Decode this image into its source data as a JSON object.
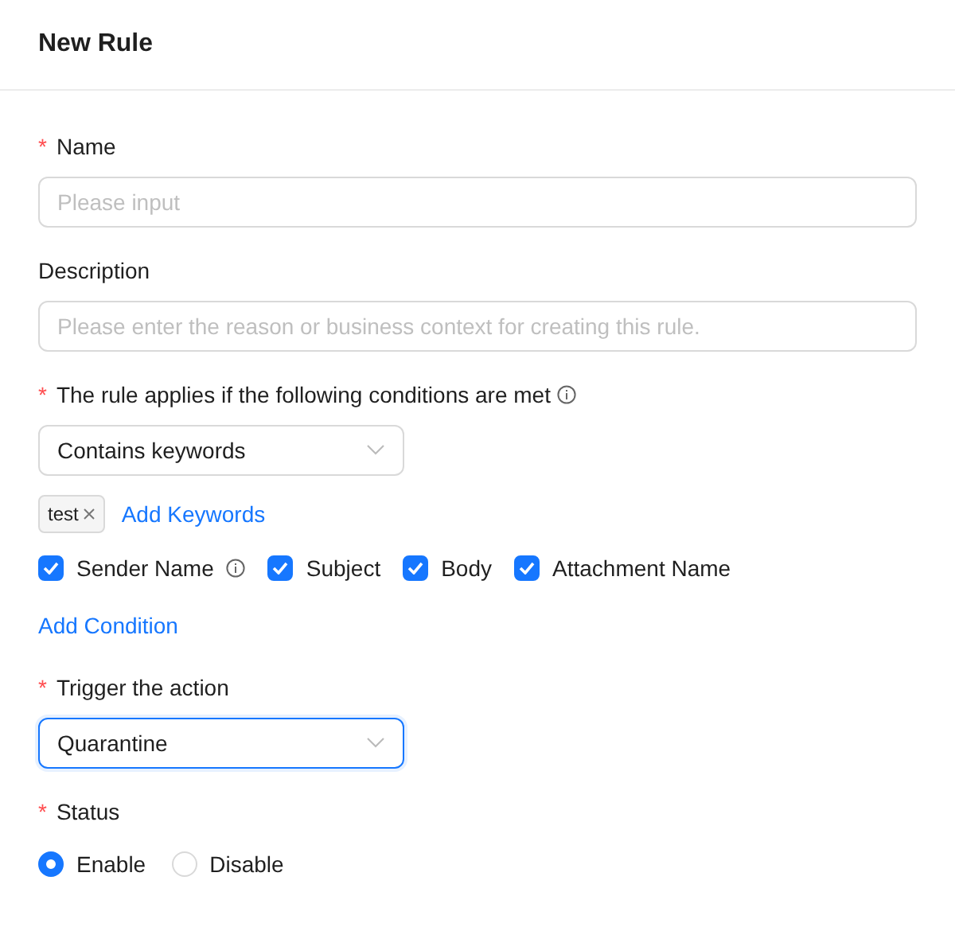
{
  "header": {
    "title": "New Rule"
  },
  "name_field": {
    "required_mark": "*",
    "label": "Name",
    "placeholder": "Please input"
  },
  "description_field": {
    "label": "Description",
    "placeholder": "Please enter the reason or business context for creating this rule."
  },
  "conditions": {
    "required_mark": "*",
    "label": "The rule applies if the following conditions are met",
    "info": true,
    "select": {
      "value": "Contains keywords",
      "focused": false
    },
    "tags": [
      {
        "label": "test"
      }
    ],
    "add_keywords": "Add Keywords",
    "checkboxes": [
      {
        "label": "Sender Name",
        "checked": true,
        "info": true
      },
      {
        "label": "Subject",
        "checked": true,
        "info": false
      },
      {
        "label": "Body",
        "checked": true,
        "info": false
      },
      {
        "label": "Attachment Name",
        "checked": true,
        "info": false
      }
    ],
    "add_condition": "Add Condition"
  },
  "action": {
    "required_mark": "*",
    "label": "Trigger the action",
    "select": {
      "value": "Quarantine",
      "focused": true
    }
  },
  "status": {
    "required_mark": "*",
    "label": "Status",
    "options": [
      {
        "label": "Enable",
        "selected": true
      },
      {
        "label": "Disable",
        "selected": false
      }
    ]
  }
}
